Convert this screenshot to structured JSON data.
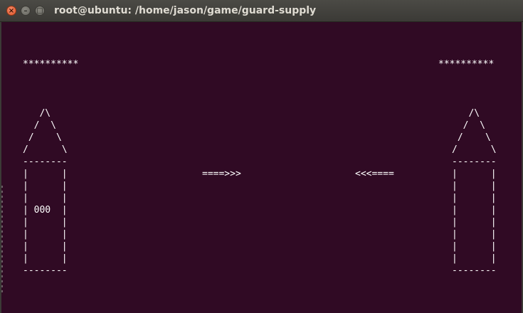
{
  "window": {
    "title": "root@ubuntu: /home/jason/game/guard-supply",
    "buttons": {
      "close_icon": "close-icon",
      "minimize_icon": "minimize-icon",
      "maximize_icon": "maximize-icon"
    }
  },
  "game": {
    "left_health": "**********",
    "right_health": "**********",
    "left_tower": "   /\\\n  /  \\\n /    \\\n/      \\\n--------\n|      |\n|      |\n|      |\n| 000  |\n|      |\n|      |\n|      |\n|      |\n--------",
    "right_tower": "   /\\\n  /  \\\n /    \\\n/      \\\n--------\n|      |\n|      |\n|      |\n|      |\n|      |\n|      |\n|      |\n|      |\n--------",
    "left_projectile": "====>>>",
    "right_projectile": "<<<===="
  },
  "colors": {
    "terminal_bg": "#300a24",
    "text": "#ffffff",
    "titlebar": "#3b3a36",
    "close_button": "#e0562b"
  }
}
